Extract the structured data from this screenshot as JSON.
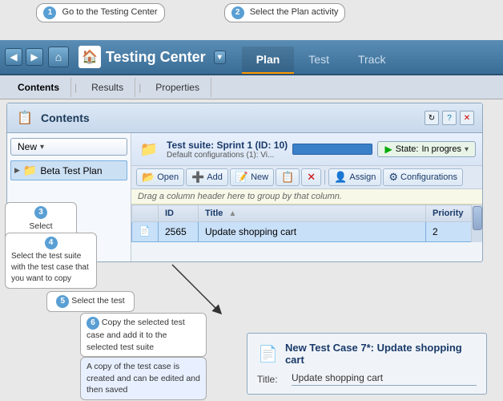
{
  "annotations": {
    "ann1": {
      "num": "1",
      "label": "Go to the Testing Center"
    },
    "ann2": {
      "num": "2",
      "label": "Select the Plan activity"
    },
    "ann3": {
      "num": "3",
      "label": "Select Contents"
    },
    "ann4": {
      "num": "4",
      "label": "Select the test suite with the test case that you want to copy"
    },
    "ann5": {
      "num": "5",
      "label": "Select the test"
    },
    "ann6": {
      "num": "6",
      "label": "Copy the selected test case and add it to the selected test suite"
    },
    "ann7": {
      "label": "A copy of the test case is created and can be edited and then saved"
    }
  },
  "navbar": {
    "title": "Testing Center",
    "tabs": [
      "Plan",
      "Test",
      "Track"
    ],
    "active_tab": "Plan"
  },
  "subtabs": {
    "items": [
      "Contents",
      "Results",
      "Properties"
    ],
    "active": "Contents"
  },
  "panel": {
    "title": "Contents",
    "tree": {
      "new_btn": "New",
      "item": "Beta Test Plan"
    },
    "suite": {
      "title": "Test suite:  Sprint 1 (ID: 10)",
      "sub": "Default configurations (1): Vi...",
      "state_label": "State:",
      "state_value": "In progres"
    },
    "toolbar_btns": [
      "Open",
      "Add",
      "New",
      "Assign",
      "Configurations"
    ],
    "drag_hint": "Drag a column header here to group by that column.",
    "table": {
      "columns": [
        "ID",
        "Title",
        "Priority"
      ],
      "row": {
        "id": "2565",
        "title": "Update shopping cart",
        "priority": "2"
      }
    }
  },
  "result_panel": {
    "title": "New Test Case 7*: Update shopping cart",
    "field_label": "Title:",
    "field_value": "Update shopping cart"
  },
  "icons": {
    "home": "⌂",
    "back": "◂",
    "forward": "▸",
    "dropdown": "▾",
    "panel_title_icon": "📋",
    "suite_icon": "📁",
    "result_icon": "📄",
    "open": "📂",
    "add": "➕",
    "new_": "📝",
    "copy": "📋",
    "delete": "✕",
    "assign": "👤",
    "config": "⚙"
  }
}
